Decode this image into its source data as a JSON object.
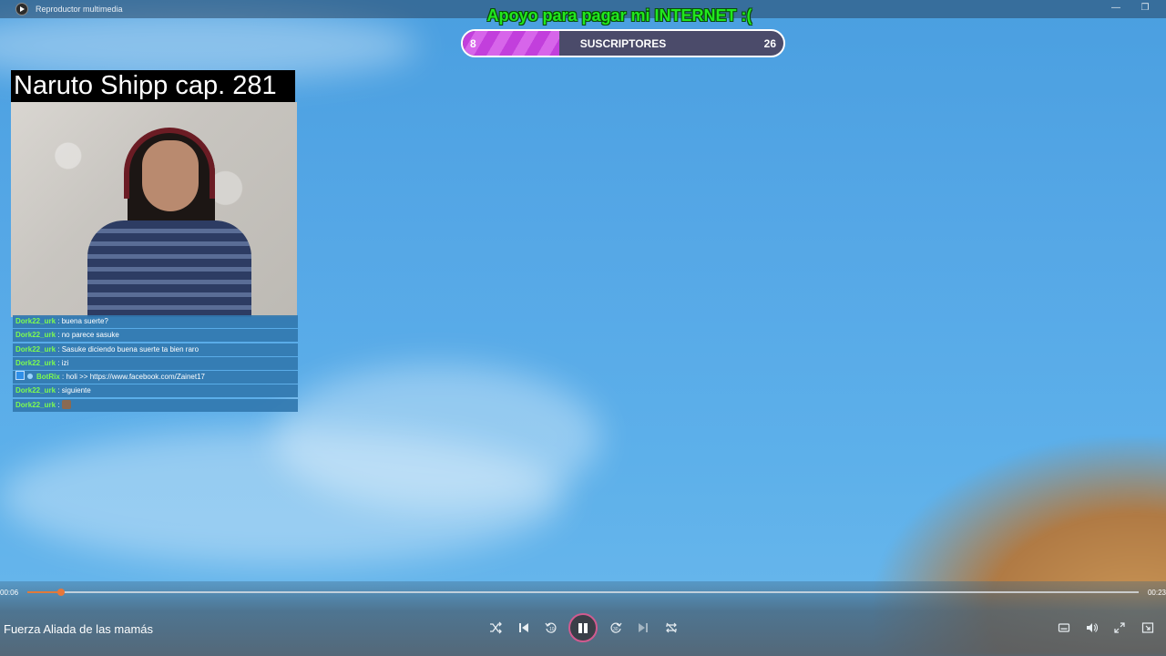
{
  "window": {
    "title": "Reproductor multimedia",
    "minimize": "—",
    "maximize": "❐"
  },
  "overlay": {
    "support_text": "Apoyo para pagar mi INTERNET :(",
    "goal": {
      "start": "8",
      "label": "SUSCRIPTORES",
      "end": "26",
      "progress": 0.3
    }
  },
  "stream": {
    "title": "Naruto Shipp cap. 281"
  },
  "chat": [
    {
      "user": "Dork22_urk",
      "message": "buena suerte?"
    },
    {
      "user": "Dork22_urk",
      "message": "no parece sasuke"
    },
    {
      "user": "Dork22_urk",
      "message": "Sasuke diciendo buena suerte ta bien raro"
    },
    {
      "user": "Dork22_urk",
      "message": "izi"
    },
    {
      "user": "BotRix",
      "message": "holi >> https://www.facebook.com/Zainet17",
      "bot": true
    },
    {
      "user": "Dork22_urk",
      "message": "siguiente"
    },
    {
      "user": "Dork22_urk",
      "message": "",
      "emote": true
    }
  ],
  "player": {
    "current_time": "00:06",
    "total_time": "00:23",
    "progress": 0.03,
    "now_playing": "Fuerza Aliada de las mamás",
    "icons": {
      "shuffle": "shuffle-icon",
      "previous": "previous-icon",
      "rewind": "rewind-10-icon",
      "pause": "pause-icon",
      "forward": "forward-30-icon",
      "next": "next-icon",
      "repeat": "repeat-icon",
      "captions": "captions-icon",
      "volume": "volume-icon",
      "fullscreen": "fullscreen-icon",
      "miniplayer": "miniplayer-icon"
    },
    "accent": "#e8773a"
  }
}
